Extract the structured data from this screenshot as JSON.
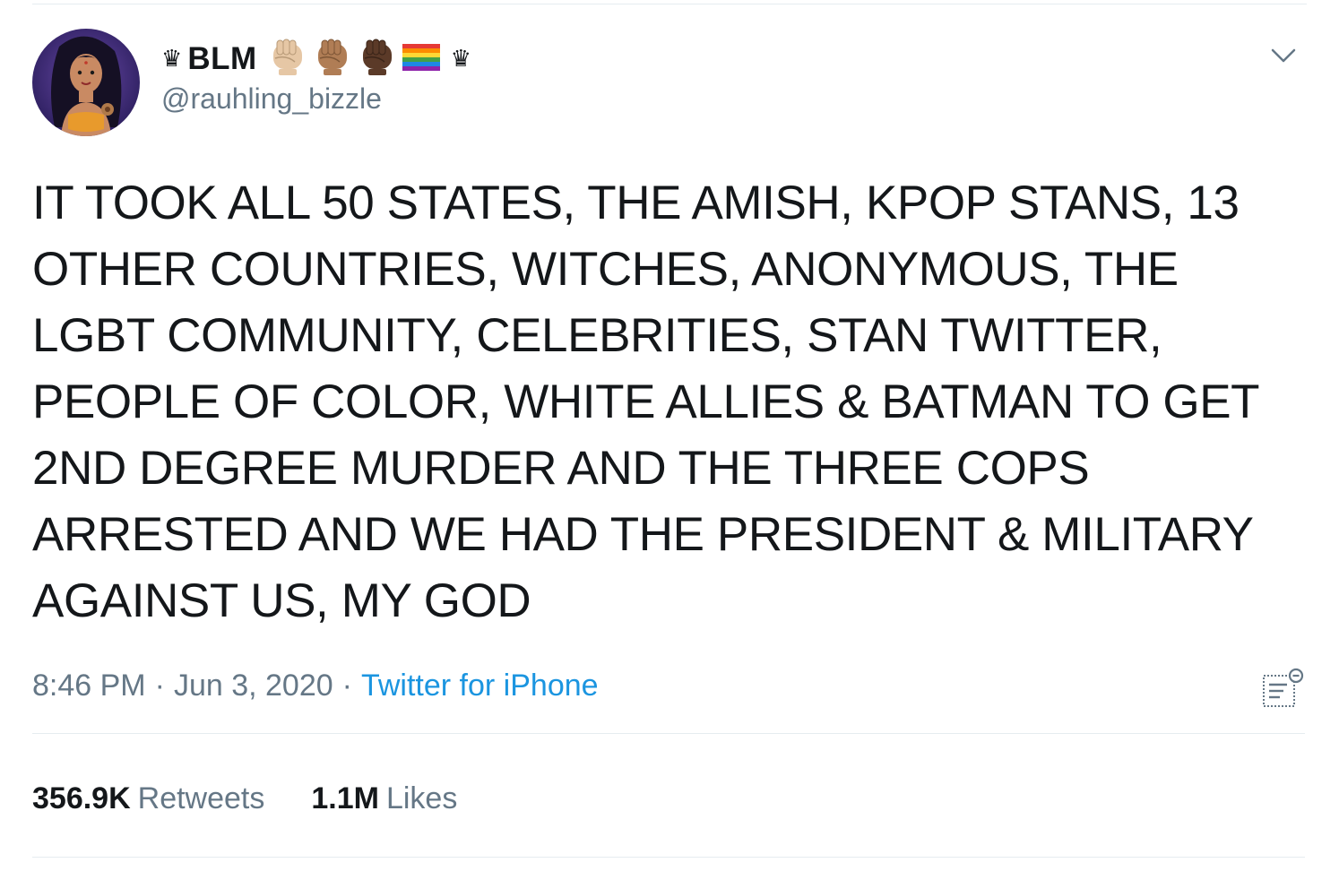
{
  "tweet": {
    "display_name": "BLM",
    "name_emojis": [
      "raised-fist-light-icon",
      "raised-fist-medium-icon",
      "raised-fist-dark-icon",
      "rainbow-flag-icon"
    ],
    "crown_glyph": "♛",
    "handle": "@rauhling_bizzle",
    "text": "IT TOOK ALL 50 STATES, THE AMISH, KPOP STANS, 13\nOTHER COUNTRIES, WITCHES, ANONYMOUS, THE\nLGBT COMMUNITY, CELEBRITIES, STAN TWITTER,\nPEOPLE OF COLOR, WHITE ALLIES & BATMAN TO GET\n2ND DEGREE MURDER AND THE THREE COPS\nARRESTED AND WE HAD THE PRESIDENT & MILITARY\nAGAINST US, MY GOD",
    "time": "8:46 PM",
    "date": "Jun 3, 2020",
    "separator": "·",
    "source": "Twitter for iPhone",
    "retweets_count": "356.9K",
    "retweets_label": "Retweets",
    "likes_count": "1.1M",
    "likes_label": "Likes"
  },
  "colors": {
    "text": "#14171a",
    "secondary": "#657786",
    "link": "#1b95e0",
    "divider": "#e6ecf0"
  }
}
